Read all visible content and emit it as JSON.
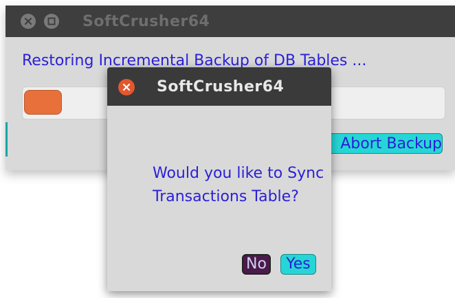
{
  "main_window": {
    "title": "SoftCrusher64",
    "status_text": "Restoring Incremental Backup of DB Tables ...",
    "progress": 0.09,
    "abort_label": "Abort Backup",
    "titlebar_buttons": [
      "close-icon",
      "maximize-icon"
    ]
  },
  "dialog": {
    "title": "SoftCrusher64",
    "message": "Would you like to Sync Transactions Table?",
    "no_label": "No",
    "yes_label": "Yes",
    "close_icon": "close-icon"
  },
  "colors": {
    "text_blue": "#2a1fd6",
    "accent_cyan": "#26d6d6",
    "progress_orange": "#e8703a",
    "close_orange": "#e4572e",
    "titlebar_dark": "#3a3a3a",
    "window_bg": "#d9d9d9"
  }
}
